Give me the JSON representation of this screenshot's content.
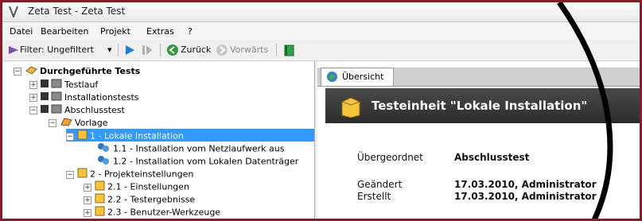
{
  "window": {
    "title": "Zeta Test - Zeta Test"
  },
  "menu": [
    "Datei",
    "Bearbeiten",
    "Projekt",
    "Extras",
    "?"
  ],
  "toolbar": {
    "filter_label": "Filter: Ungefiltert",
    "back_label": "Zurück",
    "forward_label": "Vorwärts"
  },
  "tree": {
    "root": "Durchgeführte Tests",
    "items": [
      "Testlauf",
      "Installationstests",
      "Abschlusstest",
      "Vorlage",
      "1 - Lokale Installation",
      "1.1 - Installation vom Netzlaufwerk aus",
      "1.2 - Installation vom Lokalen Datenträger",
      "2 - Projekteinstellungen",
      "2.1 - Einstellungen",
      "2.2 - Testergebnisse",
      "2.3 - Benutzer-Werkzeuge"
    ]
  },
  "panel": {
    "tab": "Übersicht",
    "heading": "Testeinheit \"Lokale Installation\"",
    "fields": {
      "parent_label": "Übergeordnet",
      "parent_value": "Abschlusstest",
      "changed_label": "Geändert",
      "changed_value": "17.03.2010, Administrator",
      "created_label": "Erstellt",
      "created_value": "17.03.2010, Administrator"
    }
  },
  "colors": {
    "frame": "#8a1c27",
    "selection": "#3399ff",
    "header": "#333333"
  }
}
